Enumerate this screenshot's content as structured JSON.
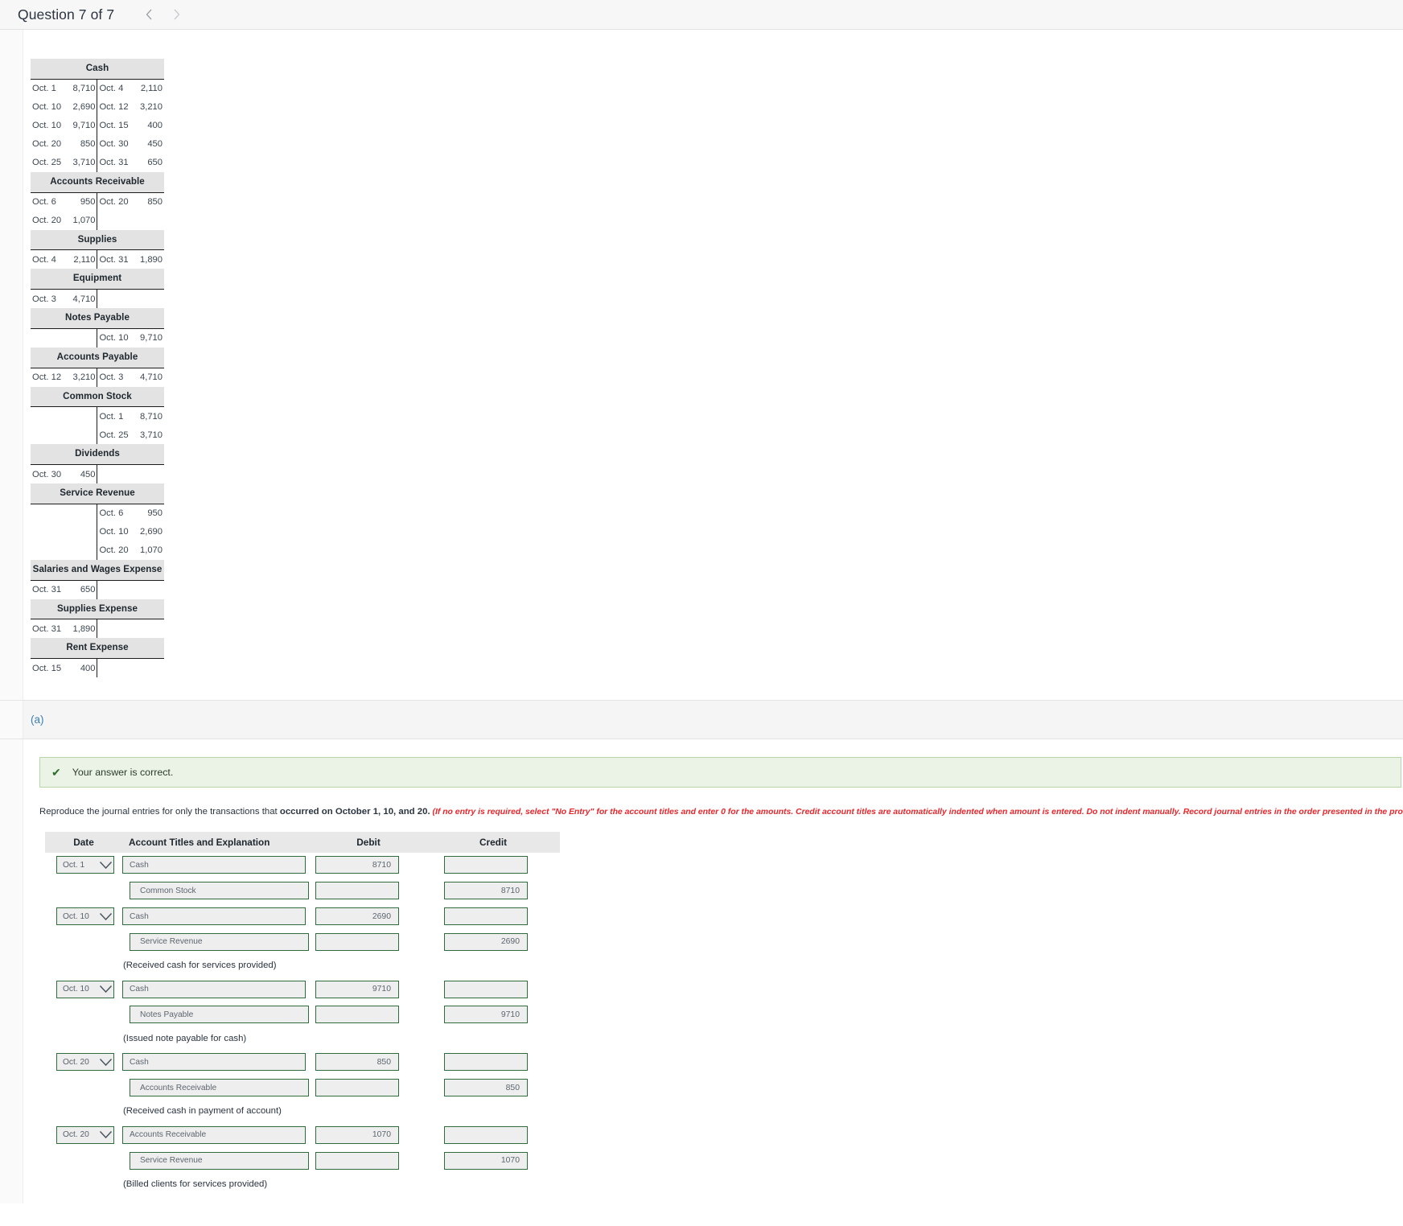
{
  "topbar": {
    "question_label": "Question 7 of 7",
    "prev_icon": "chevron-left-icon",
    "next_icon": "chevron-right-icon"
  },
  "taccounts": [
    {
      "title": "Cash",
      "rows": [
        {
          "d_date": "Oct. 1",
          "d_amt": "8,710",
          "c_date": "Oct. 4",
          "c_amt": "2,110"
        },
        {
          "d_date": "Oct. 10",
          "d_amt": "2,690",
          "c_date": "Oct. 12",
          "c_amt": "3,210"
        },
        {
          "d_date": "Oct. 10",
          "d_amt": "9,710",
          "c_date": "Oct. 15",
          "c_amt": "400"
        },
        {
          "d_date": "Oct. 20",
          "d_amt": "850",
          "c_date": "Oct. 30",
          "c_amt": "450"
        },
        {
          "d_date": "Oct. 25",
          "d_amt": "3,710",
          "c_date": "Oct. 31",
          "c_amt": "650"
        }
      ]
    },
    {
      "title": "Accounts Receivable",
      "rows": [
        {
          "d_date": "Oct. 6",
          "d_amt": "950",
          "c_date": "Oct. 20",
          "c_amt": "850"
        },
        {
          "d_date": "Oct. 20",
          "d_amt": "1,070",
          "c_date": "",
          "c_amt": ""
        }
      ]
    },
    {
      "title": "Supplies",
      "rows": [
        {
          "d_date": "Oct. 4",
          "d_amt": "2,110",
          "c_date": "Oct. 31",
          "c_amt": "1,890"
        }
      ]
    },
    {
      "title": "Equipment",
      "rows": [
        {
          "d_date": "Oct. 3",
          "d_amt": "4,710",
          "c_date": "",
          "c_amt": ""
        }
      ]
    },
    {
      "title": "Notes Payable",
      "rows": [
        {
          "d_date": "",
          "d_amt": "",
          "c_date": "Oct. 10",
          "c_amt": "9,710"
        }
      ]
    },
    {
      "title": "Accounts Payable",
      "rows": [
        {
          "d_date": "Oct. 12",
          "d_amt": "3,210",
          "c_date": "Oct. 3",
          "c_amt": "4,710"
        }
      ]
    },
    {
      "title": "Common Stock",
      "rows": [
        {
          "d_date": "",
          "d_amt": "",
          "c_date": "Oct. 1",
          "c_amt": "8,710"
        },
        {
          "d_date": "",
          "d_amt": "",
          "c_date": "Oct. 25",
          "c_amt": "3,710"
        }
      ]
    },
    {
      "title": "Dividends",
      "rows": [
        {
          "d_date": "Oct. 30",
          "d_amt": "450",
          "c_date": "",
          "c_amt": ""
        }
      ]
    },
    {
      "title": "Service Revenue",
      "rows": [
        {
          "d_date": "",
          "d_amt": "",
          "c_date": "Oct. 6",
          "c_amt": "950"
        },
        {
          "d_date": "",
          "d_amt": "",
          "c_date": "Oct. 10",
          "c_amt": "2,690"
        },
        {
          "d_date": "",
          "d_amt": "",
          "c_date": "Oct. 20",
          "c_amt": "1,070"
        }
      ]
    },
    {
      "title": "Salaries and Wages Expense",
      "rows": [
        {
          "d_date": "Oct. 31",
          "d_amt": "650",
          "c_date": "",
          "c_amt": ""
        }
      ]
    },
    {
      "title": "Supplies Expense",
      "rows": [
        {
          "d_date": "Oct. 31",
          "d_amt": "1,890",
          "c_date": "",
          "c_amt": ""
        }
      ]
    },
    {
      "title": "Rent Expense",
      "rows": [
        {
          "d_date": "Oct. 15",
          "d_amt": "400",
          "c_date": "",
          "c_amt": ""
        }
      ]
    }
  ],
  "part": {
    "label": "(a)",
    "feedback": {
      "icon": "checkmark-icon",
      "text": "Your answer is correct.",
      "bg_color": "#eaf3e6",
      "border_color": "#b9d5ab",
      "text_color": "#2e3c2b"
    },
    "instruction": {
      "lead": "Reproduce the journal entries for only the transactions that ",
      "bold": "occurred on October 1, 10, and 20.",
      "italic_red": " (If no entry is required, select \"No Entry\" for the account titles and enter 0 for the amounts. Credit account titles are automatically indented when amount is entered. Do not indent manually. Record journal entries in the order presented in the problem. List all debit entries before credit entries.)",
      "red_color": "#e8262b"
    }
  },
  "journal": {
    "headers": {
      "date": "Date",
      "account": "Account Titles and Explanation",
      "debit": "Debit",
      "credit": "Credit"
    },
    "accent_border": "#2f6b3c",
    "field_bg": "#eeeeee",
    "chevron_icon": "chevron-down-icon",
    "entries": [
      {
        "date": "Oct. 1",
        "lines": [
          {
            "account": "Cash",
            "debit": "8710",
            "credit": "",
            "indent": false
          },
          {
            "account": "Common Stock",
            "debit": "",
            "credit": "8710",
            "indent": true
          }
        ],
        "explanation": ""
      },
      {
        "date": "Oct. 10",
        "lines": [
          {
            "account": "Cash",
            "debit": "2690",
            "credit": "",
            "indent": false
          },
          {
            "account": "Service Revenue",
            "debit": "",
            "credit": "2690",
            "indent": true
          }
        ],
        "explanation": "(Received cash for services provided)"
      },
      {
        "date": "Oct. 10",
        "lines": [
          {
            "account": "Cash",
            "debit": "9710",
            "credit": "",
            "indent": false
          },
          {
            "account": "Notes Payable",
            "debit": "",
            "credit": "9710",
            "indent": true
          }
        ],
        "explanation": "(Issued note payable for cash)"
      },
      {
        "date": "Oct. 20",
        "lines": [
          {
            "account": "Cash",
            "debit": "850",
            "credit": "",
            "indent": false
          },
          {
            "account": "Accounts Receivable",
            "debit": "",
            "credit": "850",
            "indent": true
          }
        ],
        "explanation": "(Received cash in payment of account)"
      },
      {
        "date": "Oct. 20",
        "lines": [
          {
            "account": "Accounts Receivable",
            "debit": "1070",
            "credit": "",
            "indent": false
          },
          {
            "account": "Service Revenue",
            "debit": "",
            "credit": "1070",
            "indent": true
          }
        ],
        "explanation": "(Billed clients for services provided)"
      }
    ]
  }
}
